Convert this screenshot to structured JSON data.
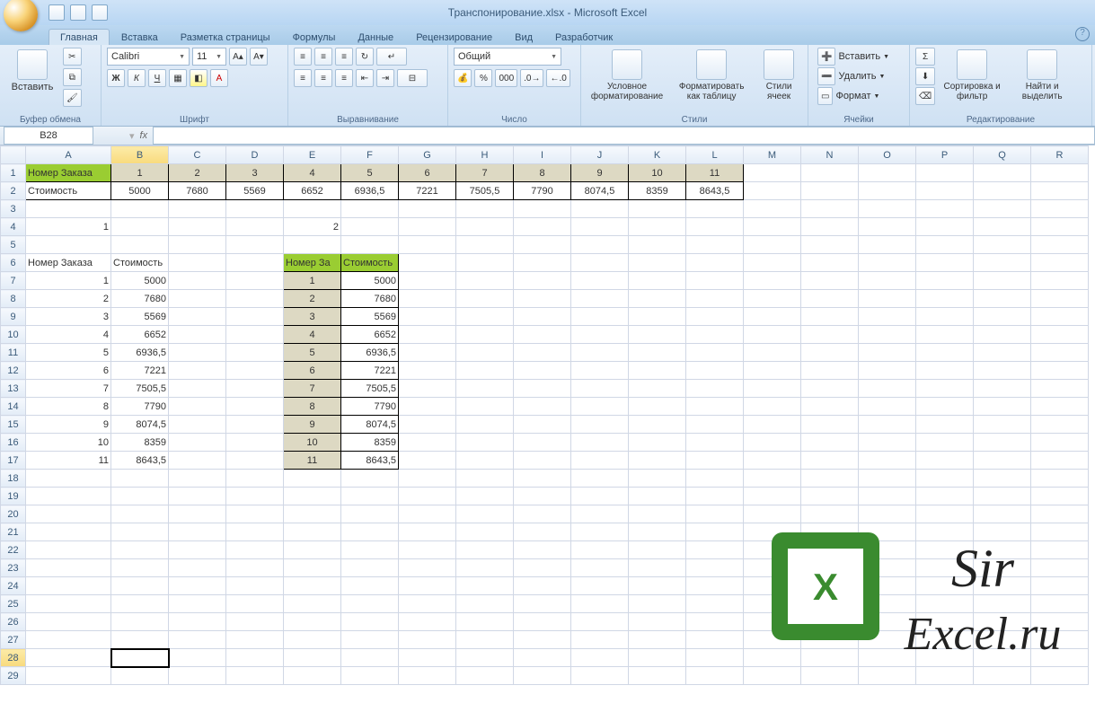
{
  "title": "Транспонирование.xlsx - Microsoft Excel",
  "qat": [
    "save-icon",
    "undo-icon",
    "redo-icon"
  ],
  "ribbonTabs": [
    "Главная",
    "Вставка",
    "Разметка страницы",
    "Формулы",
    "Данные",
    "Рецензирование",
    "Вид",
    "Разработчик"
  ],
  "activeTab": 0,
  "groups": {
    "clipboard": {
      "label": "Буфер обмена",
      "paste": "Вставить"
    },
    "font": {
      "label": "Шрифт",
      "family": "Calibri",
      "size": "11"
    },
    "align": {
      "label": "Выравнивание"
    },
    "number": {
      "label": "Число",
      "format": "Общий"
    },
    "styles": {
      "label": "Стили",
      "cond": "Условное форматирование",
      "asTable": "Форматировать как таблицу",
      "cellStyles": "Стили ячеек"
    },
    "cells": {
      "label": "Ячейки",
      "insert": "Вставить",
      "delete": "Удалить",
      "format": "Формат"
    },
    "editing": {
      "label": "Редактирование",
      "sort": "Сортировка и фильтр",
      "find": "Найти и выделить"
    }
  },
  "nameBox": "B28",
  "formula": "",
  "columns": [
    "A",
    "B",
    "C",
    "D",
    "E",
    "F",
    "G",
    "H",
    "I",
    "J",
    "K",
    "L",
    "M",
    "N",
    "O",
    "P",
    "Q",
    "R"
  ],
  "rows": 29,
  "selected": {
    "row": 28,
    "col": "B"
  },
  "colWidths": {
    "A": 95,
    "B": 64,
    "C": 64,
    "D": 64,
    "E": 64,
    "F": 64,
    "G": 64,
    "H": 64,
    "I": 64,
    "J": 64,
    "K": 64,
    "L": 64,
    "M": 64,
    "N": 64,
    "O": 64,
    "P": 64,
    "Q": 64,
    "R": 64
  },
  "cells": {
    "A1": "Номер Заказа",
    "B1": "1",
    "C1": "2",
    "D1": "3",
    "E1": "4",
    "F1": "5",
    "G1": "6",
    "H1": "7",
    "I1": "8",
    "J1": "9",
    "K1": "10",
    "L1": "11",
    "A2": "Стоимость",
    "B2": "5000",
    "C2": "7680",
    "D2": "5569",
    "E2": "6652",
    "F2": "6936,5",
    "G2": "7221",
    "H2": "7505,5",
    "I2": "7790",
    "J2": "8074,5",
    "K2": "8359",
    "L2": "8643,5",
    "A4": "1",
    "E4": "2",
    "A6": "Номер Заказа",
    "B6": "Стоимость",
    "E6": "Номер За",
    "F6": "Стоимость",
    "A7": "1",
    "B7": "5000",
    "E7": "1",
    "F7": "5000",
    "A8": "2",
    "B8": "7680",
    "E8": "2",
    "F8": "7680",
    "A9": "3",
    "B9": "5569",
    "E9": "3",
    "F9": "5569",
    "A10": "4",
    "B10": "6652",
    "E10": "4",
    "F10": "6652",
    "A11": "5",
    "B11": "6936,5",
    "E11": "5",
    "F11": "6936,5",
    "A12": "6",
    "B12": "7221",
    "E12": "6",
    "F12": "7221",
    "A13": "7",
    "B13": "7505,5",
    "E13": "7",
    "F13": "7505,5",
    "A14": "8",
    "B14": "7790",
    "E14": "8",
    "F14": "7790",
    "A15": "9",
    "B15": "8074,5",
    "E15": "9",
    "F15": "8074,5",
    "A16": "10",
    "B16": "8359",
    "E16": "10",
    "F16": "8359",
    "A17": "11",
    "B17": "8643,5",
    "E17": "11",
    "F17": "8643,5"
  },
  "watermark": {
    "lines": [
      "Sir",
      "Excel.ru"
    ]
  }
}
